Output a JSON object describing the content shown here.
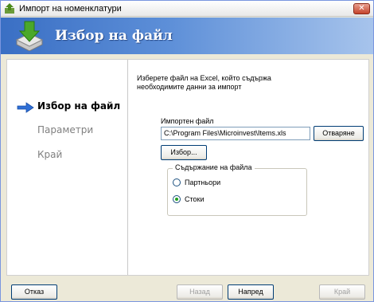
{
  "window": {
    "title": "Импорт на номенклатури",
    "close_label": "✕"
  },
  "banner": {
    "title": "Избор на файл",
    "icon": "download-arrow-icon"
  },
  "steps": [
    {
      "label": "Избор на файл",
      "active": true
    },
    {
      "label": "Параметри",
      "active": false
    },
    {
      "label": "Край",
      "active": false
    }
  ],
  "main": {
    "description": "Изберете файл на Excel, който съдържа необходимите данни за импорт",
    "file_label": "Импортен файл",
    "file_value": "C:\\Program Files\\Microinvest\\Items.xls",
    "open_label": "Отваряне",
    "browse_label": "Избор...",
    "group_label": "Съдържание на файла",
    "options": [
      {
        "label": "Партньори",
        "checked": false
      },
      {
        "label": "Стоки",
        "checked": true
      }
    ]
  },
  "footer": {
    "cancel_label": "Отказ",
    "back_label": "Назад",
    "next_label": "Напред",
    "finish_label": "Край"
  },
  "colors": {
    "banner_start": "#3a6fc4",
    "banner_end": "#a7c4ec",
    "arrow": "#2f6fd6"
  }
}
